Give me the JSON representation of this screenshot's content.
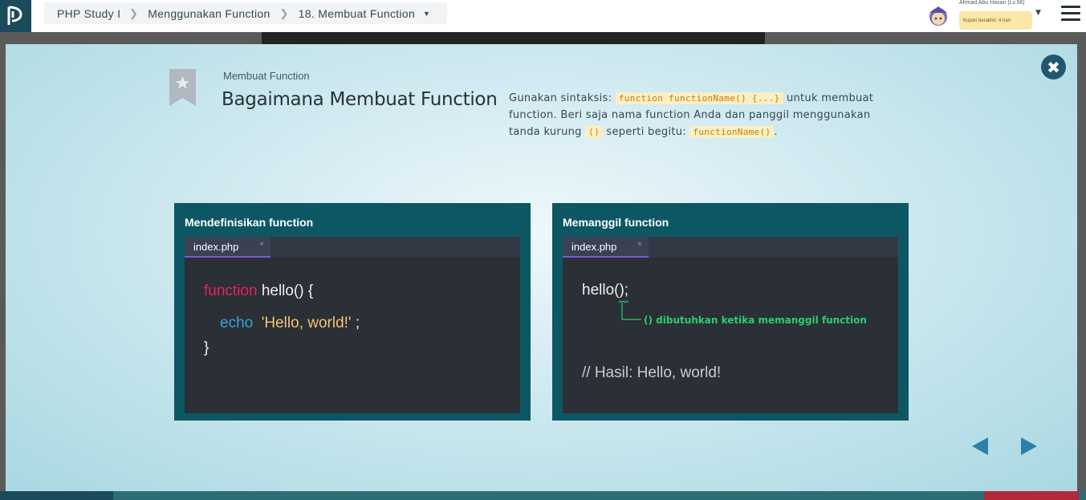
{
  "breadcrumb": {
    "course": "PHP Study I",
    "chapter": "Menggunakan Function",
    "lesson": "18. Membuat Function"
  },
  "user": {
    "name": "Ahmad Abu Hasan (Lv.56)",
    "coupon": "Kupon berakhir: 4 hari"
  },
  "slide": {
    "subtitle": "Membuat Function",
    "title": "Bagaimana Membuat Function",
    "desc_1": "Gunakan sintaksis: ",
    "desc_code_1": "function functionName() {...}",
    "desc_2": " untuk membuat function. Beri saja nama function Anda dan panggil menggunakan tanda kurung ",
    "desc_code_2": "()",
    "desc_3": " seperti begitu: ",
    "desc_code_3": "functionName()",
    "desc_4": "."
  },
  "left_panel": {
    "title": "Mendefinisikan function",
    "tab": "index.php",
    "tab_close": "×",
    "line1_kw": "function",
    "line1_rest": " hello() {",
    "line2_kw": "echo",
    "line2_str": "'Hello, world!'",
    "line2_end": " ;",
    "line3": "}"
  },
  "right_panel": {
    "title": "Memanggil function",
    "tab": "index.php",
    "tab_close": "×",
    "line1": "hello();",
    "note": "() dibutuhkan ketika memanggil function",
    "result": "// Hasil: Hello, world!"
  },
  "close_symbol": "✖",
  "colors": {
    "accent_dark": "#1b4a5a",
    "panel_bg": "#0d5764",
    "keyword_red": "#e0245e",
    "keyword_blue": "#3aa2d6",
    "string_yellow": "#f0c674",
    "note_green": "#2ecc71",
    "nav_arrow": "#2e7fa8"
  },
  "icons": {
    "logo": "progate-logo-icon",
    "bookmark": "star-bookmark-icon",
    "close": "close-icon",
    "menu": "hamburger-menu-icon",
    "prev": "arrow-left-icon",
    "next": "arrow-right-icon"
  }
}
